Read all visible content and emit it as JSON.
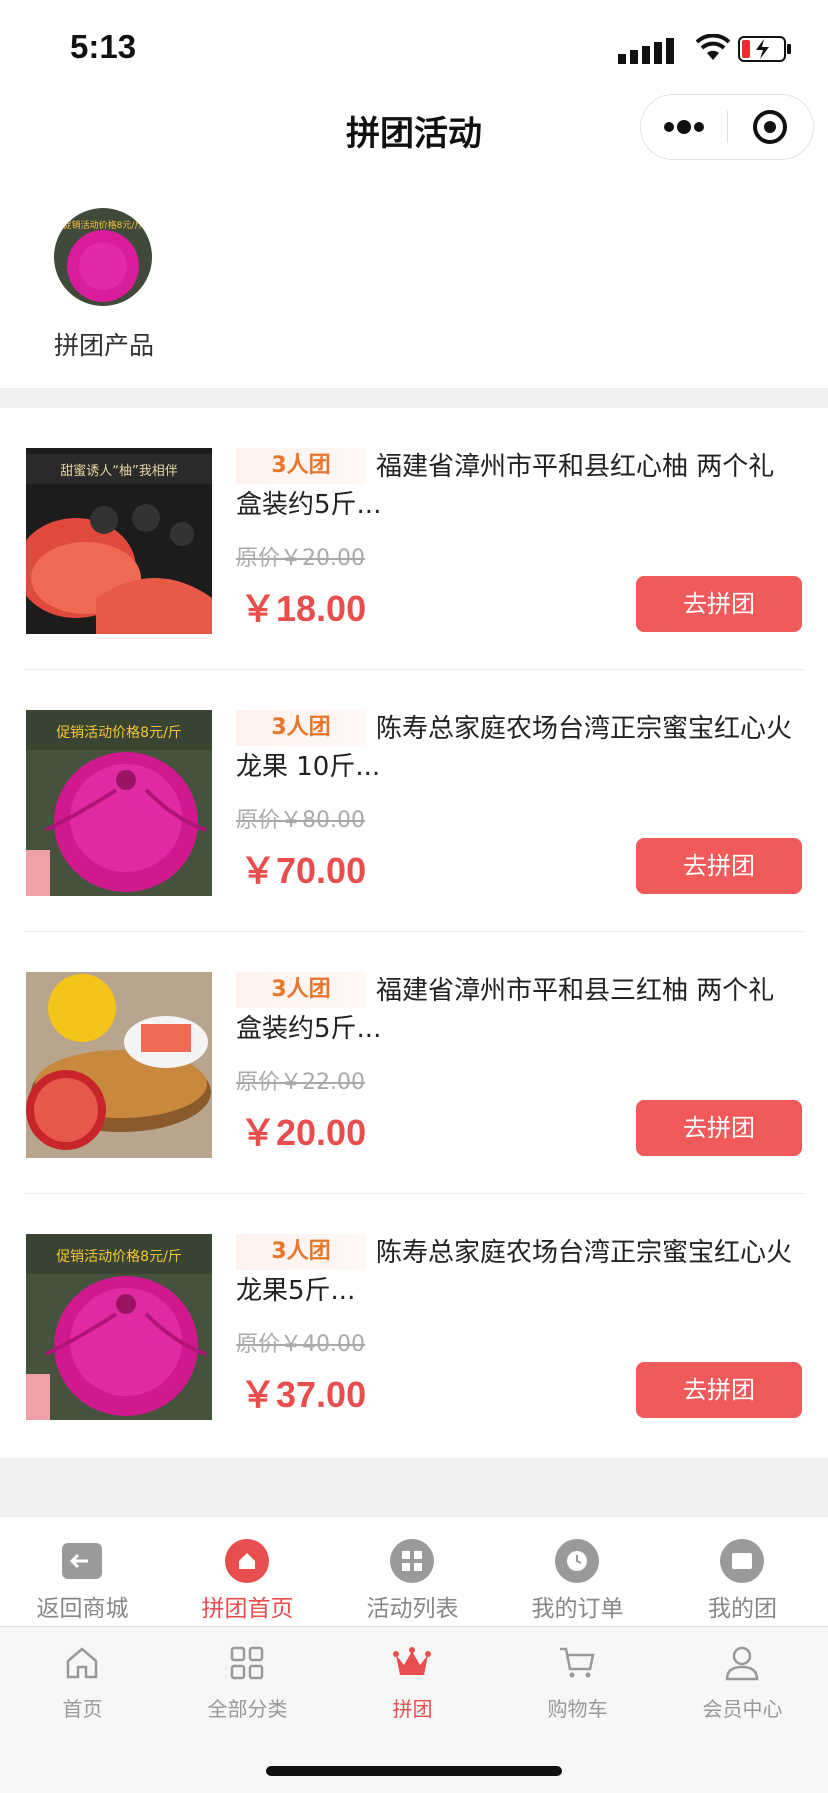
{
  "status_bar": {
    "time": "5:13"
  },
  "header": {
    "title": "拼团活动"
  },
  "category": {
    "label": "拼团产品",
    "banner_text": "促销活动价格8元/斤"
  },
  "products": [
    {
      "badge": "3人团",
      "title": "福建省漳州市平和县红心柚 两个礼盒装约5斤...",
      "original_price": "原价￥20.00",
      "price": "￥18.00",
      "button": "去拼团",
      "image_text": "甜蜜诱人“柚”我相伴"
    },
    {
      "badge": "3人团",
      "title": "陈寿总家庭农场台湾正宗蜜宝红心火龙果 10斤...",
      "original_price": "原价￥80.00",
      "price": "￥70.00",
      "button": "去拼团",
      "image_text": "促销活动价格8元/斤"
    },
    {
      "badge": "3人团",
      "title": "福建省漳州市平和县三红柚 两个礼盒装约5斤...",
      "original_price": "原价￥22.00",
      "price": "￥20.00",
      "button": "去拼团",
      "image_text": ""
    },
    {
      "badge": "3人团",
      "title": "陈寿总家庭农场台湾正宗蜜宝红心火龙果5斤...",
      "original_price": "原价￥40.00",
      "price": "￥37.00",
      "button": "去拼团",
      "image_text": "促销活动价格8元/斤"
    }
  ],
  "group_tabs": [
    {
      "label": "返回商城",
      "icon": "exit-icon"
    },
    {
      "label": "拼团首页",
      "icon": "home-icon",
      "active": true
    },
    {
      "label": "活动列表",
      "icon": "grid-icon"
    },
    {
      "label": "我的订单",
      "icon": "clock-icon"
    },
    {
      "label": "我的团",
      "icon": "wallet-icon"
    }
  ],
  "main_tabs": [
    {
      "label": "首页",
      "icon": "home-outline-icon"
    },
    {
      "label": "全部分类",
      "icon": "category-icon"
    },
    {
      "label": "拼团",
      "icon": "crown-icon",
      "active": true
    },
    {
      "label": "购物车",
      "icon": "cart-icon"
    },
    {
      "label": "会员中心",
      "icon": "user-icon"
    }
  ],
  "colors": {
    "accent": "#e84e4e",
    "button": "#f15a5a",
    "badge_text": "#e8762a"
  }
}
